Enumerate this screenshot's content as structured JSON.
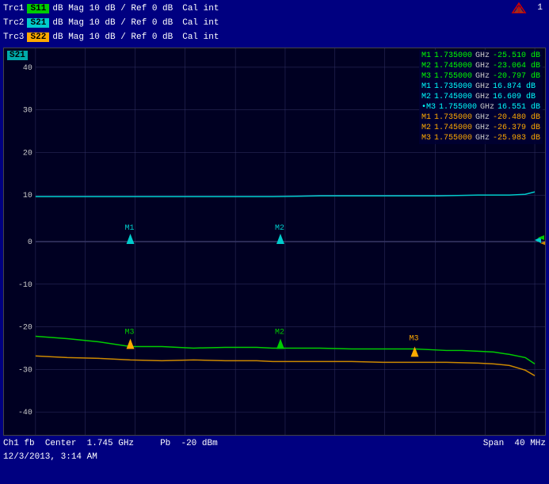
{
  "traces": [
    {
      "id": "Trc1",
      "badge": "S11",
      "badgeClass": "badge-s11",
      "info": "dB Mag  10 dB /  Ref 0 dB",
      "cal": "Cal int"
    },
    {
      "id": "Trc2",
      "badge": "S21",
      "badgeClass": "badge-s21",
      "info": "dB Mag  10 dB /  Ref 0 dB",
      "cal": "Cal int"
    },
    {
      "id": "Trc3",
      "badge": "S22",
      "badgeClass": "badge-s22",
      "info": "dB Mag  10 dB /  Ref 0 dB",
      "cal": "Cal int"
    }
  ],
  "channel": "1",
  "s21_label": "S21",
  "markers": {
    "green": [
      {
        "label": "M1",
        "freq": "1.735000",
        "unit": "GHz",
        "val": "-25.510 dB"
      },
      {
        "label": "M2",
        "freq": "1.745000",
        "unit": "GHz",
        "val": "-23.064 dB"
      },
      {
        "label": "M3",
        "freq": "1.755000",
        "unit": "GHz",
        "val": "-20.797 dB"
      }
    ],
    "cyan": [
      {
        "label": "M1",
        "freq": "1.735000",
        "unit": "GHz",
        "val": "16.874 dB"
      },
      {
        "label": "M2",
        "freq": "1.745000",
        "unit": "GHz",
        "val": "16.609 dB"
      },
      {
        "label": "•M3",
        "freq": "1.755000",
        "unit": "GHz",
        "val": "16.551 dB"
      }
    ],
    "orange": [
      {
        "label": "M1",
        "freq": "1.735000",
        "unit": "GHz",
        "val": "-20.480 dB"
      },
      {
        "label": "M2",
        "freq": "1.745000",
        "unit": "GHz",
        "val": "-26.379 dB"
      },
      {
        "label": "M3",
        "freq": "1.755000",
        "unit": "GHz",
        "val": "-25.983 dB"
      }
    ]
  },
  "yAxis": {
    "labels": [
      "40",
      "30",
      "20",
      "10",
      "0",
      "-10",
      "-20",
      "-30",
      "-40"
    ]
  },
  "bottom": {
    "ch": "Ch1  fb",
    "center_label": "Center",
    "center_val": "1.745 GHz",
    "pb_label": "Pb",
    "pb_val": "-20 dBm",
    "span_label": "Span",
    "span_val": "40 MHz"
  },
  "date": "12/3/2013, 3:14 AM"
}
